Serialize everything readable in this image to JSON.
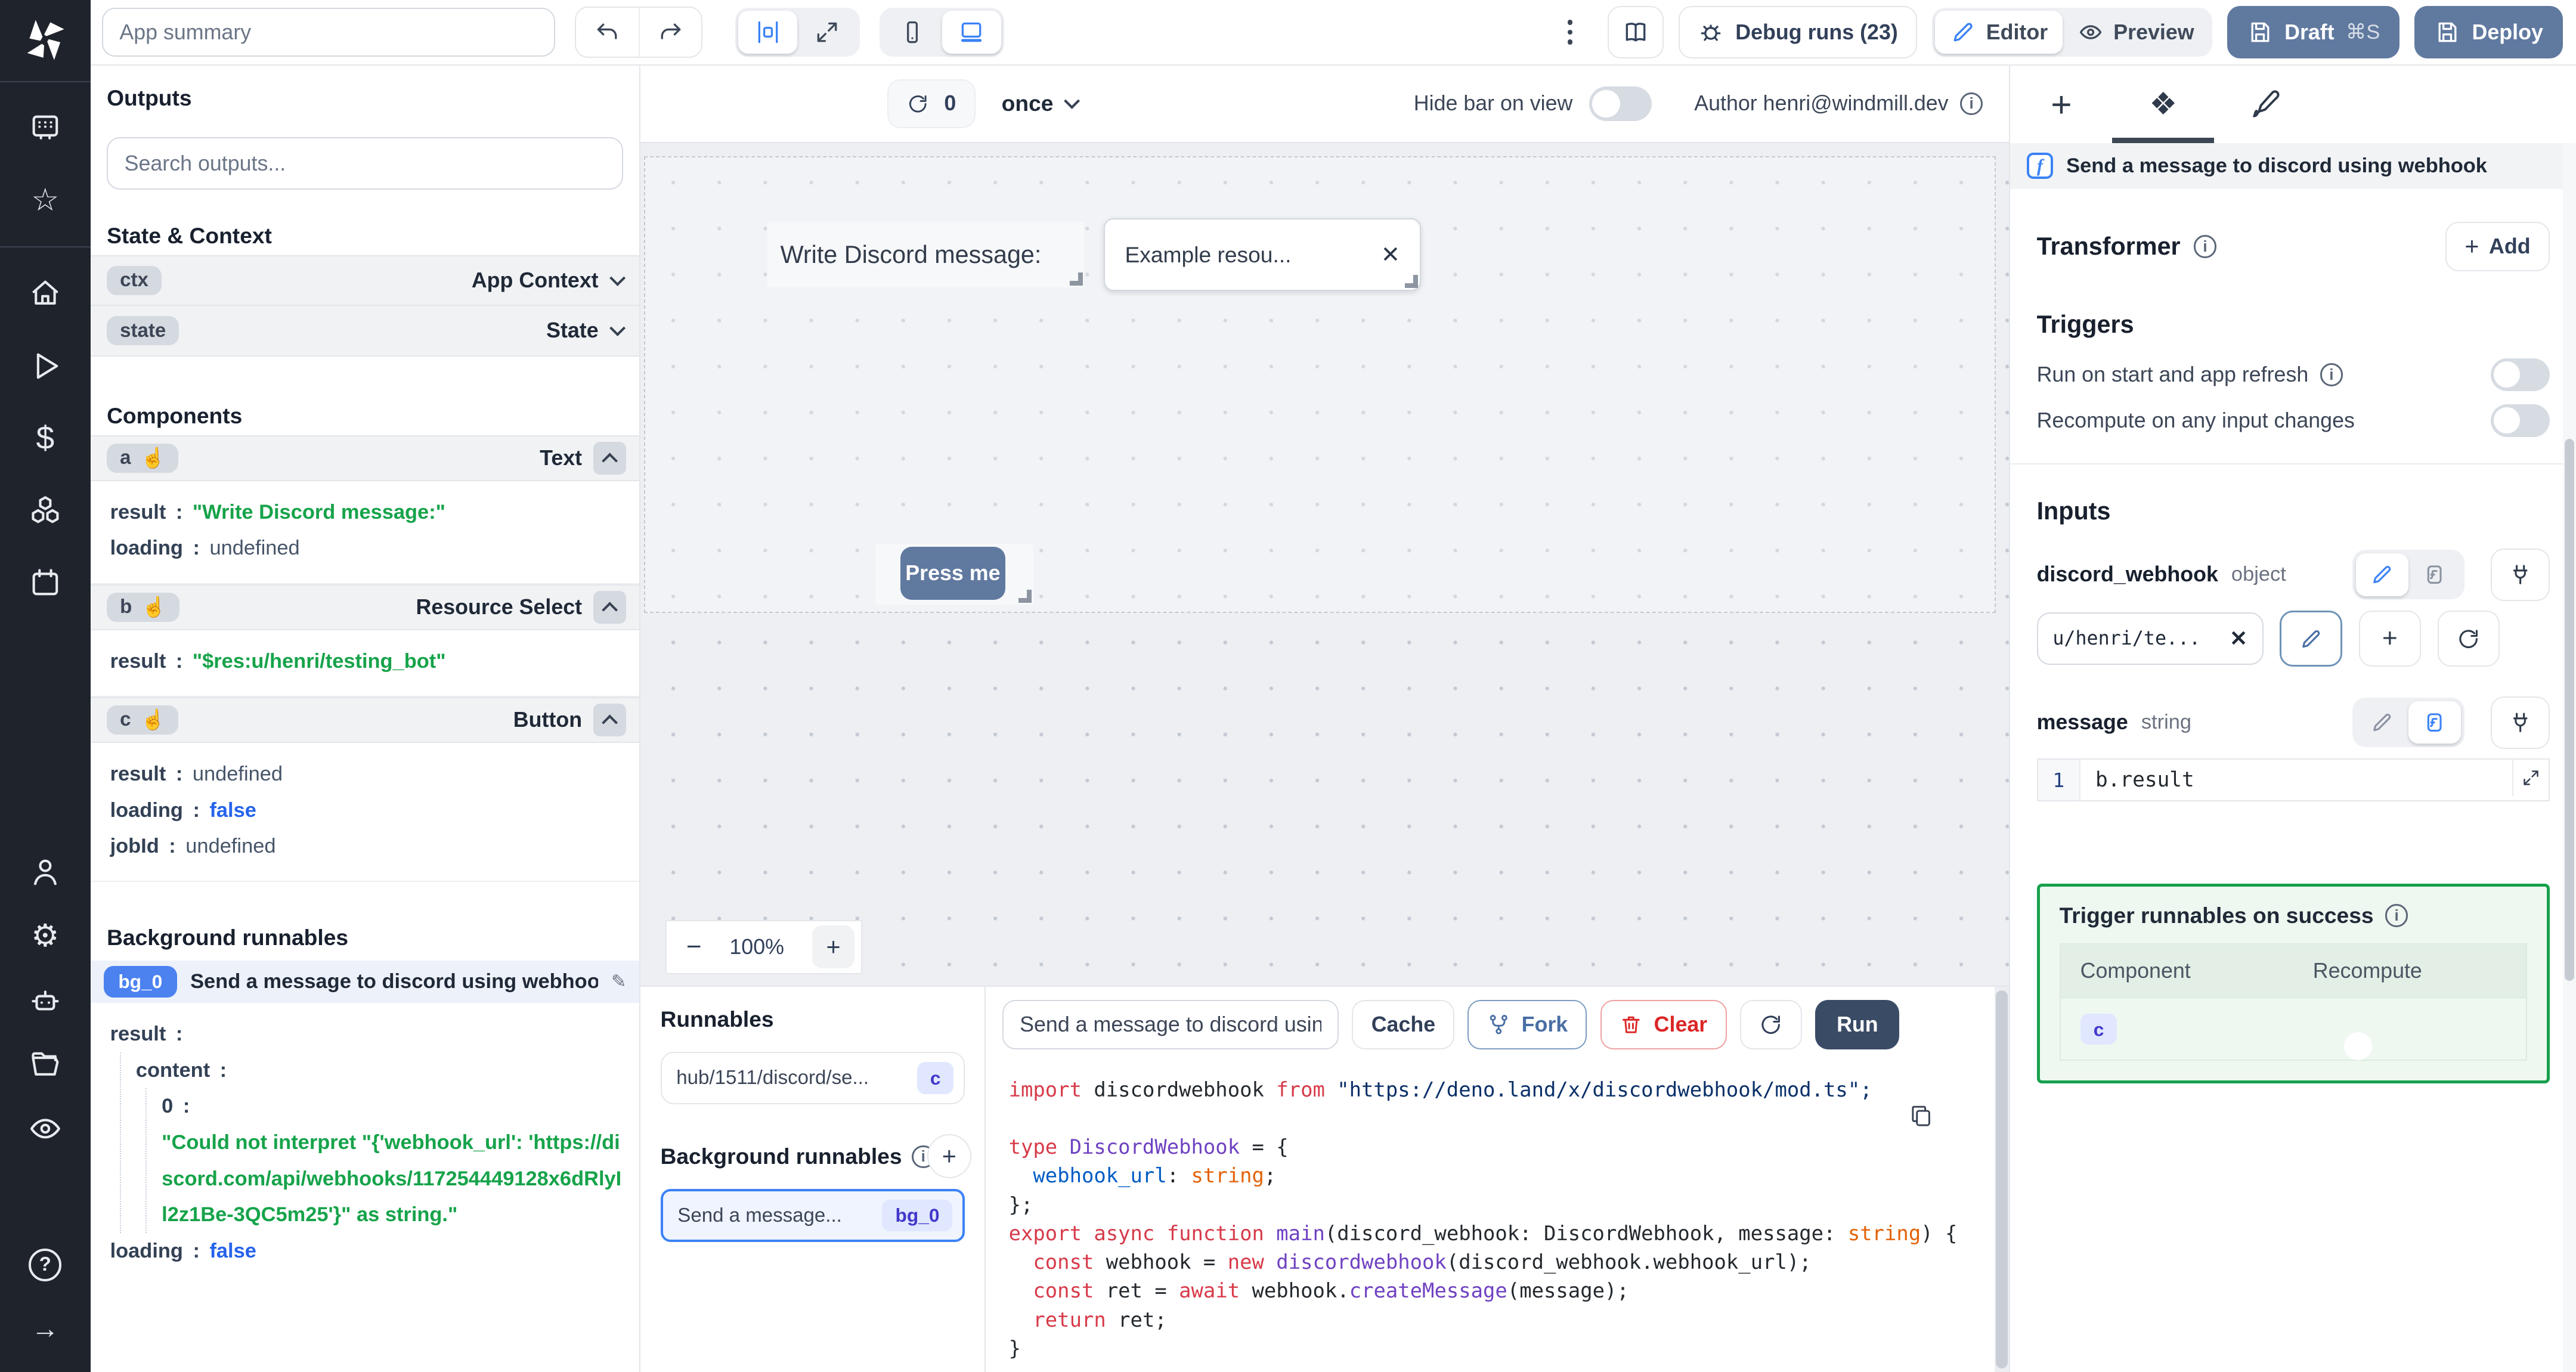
{
  "topbar": {
    "app_summary_placeholder": "App summary",
    "debug_runs": "Debug runs (23)",
    "editor": "Editor",
    "preview": "Preview",
    "draft": "Draft",
    "draft_shortcut": "⌘S",
    "deploy": "Deploy"
  },
  "canvas": {
    "refresh_count": "0",
    "schedule": "once",
    "hide_bar": "Hide bar on view",
    "author": "Author henri@windmill.dev",
    "text_component": "Write Discord message:",
    "select_value": "Example resou...",
    "button_label": "Press me",
    "zoom_level": "100%"
  },
  "outputs": {
    "title": "Outputs",
    "search_placeholder": "Search outputs...",
    "state_context": "State & Context",
    "ctx_id": "ctx",
    "ctx_type": "App Context",
    "state_id": "state",
    "state_type": "State",
    "components": "Components",
    "a_id": "a",
    "a_type": "Text",
    "a_result_k": "result",
    "a_result_v": "\"Write Discord message:\"",
    "a_loading_k": "loading",
    "a_loading_v": "undefined",
    "b_id": "b",
    "b_type": "Resource Select",
    "b_result_k": "result",
    "b_result_v": "\"$res:u/henri/testing_bot\"",
    "c_id": "c",
    "c_type": "Button",
    "c_result_k": "result",
    "c_result_v": "undefined",
    "c_loading_k": "loading",
    "c_loading_v": "false",
    "c_jobid_k": "jobId",
    "c_jobid_v": "undefined",
    "bg_title": "Background runnables",
    "bg_badge": "bg_0",
    "bg_label": "Send a message to discord using webhook",
    "bg_result_k": "result",
    "bg_content_k": "content",
    "bg_index_k": "0",
    "bg_error": "\"Could not interpret \"{'webhook_url': 'https://discord.com/api/webhooks/117254449128x6dRlyIl2z1Be-3QC5m25'}\" as string.\"",
    "bg_loading_k": "loading",
    "bg_loading_v": "false"
  },
  "runnables": {
    "title": "Runnables",
    "item_label": "hub/1511/discord/se...",
    "item_badge": "c",
    "bg_title": "Background runnables",
    "bg_label": "Send a message...",
    "bg_badge": "bg_0"
  },
  "editor": {
    "name_value": "Send a message to discord using",
    "cache": "Cache",
    "fork": "Fork",
    "clear": "Clear",
    "run": "Run",
    "lines": [
      [
        [
          "kw",
          "import"
        ],
        [
          "pl",
          " discordwebhook "
        ],
        [
          "kw",
          "from"
        ],
        [
          "str",
          " \"https://deno.land/x/discordwebhook/mod.ts\";"
        ]
      ],
      [],
      [
        [
          "kw",
          "type"
        ],
        [
          "ty",
          " DiscordWebhook"
        ],
        [
          "pl",
          " = {"
        ]
      ],
      [
        [
          "pr",
          "  webhook_url"
        ],
        [
          "pl",
          ": "
        ],
        [
          "or",
          "string"
        ],
        [
          "pl",
          ";"
        ]
      ],
      [
        [
          "pl",
          "};"
        ]
      ],
      [
        [
          "kw",
          "export async function"
        ],
        [
          "fn",
          " main"
        ],
        [
          "pl",
          "(discord_webhook: DiscordWebhook, message: "
        ],
        [
          "or",
          "string"
        ],
        [
          "pl",
          ") {"
        ]
      ],
      [
        [
          "pl",
          "  "
        ],
        [
          "kw",
          "const"
        ],
        [
          "pl",
          " webhook = "
        ],
        [
          "kw",
          "new"
        ],
        [
          "ty",
          " discordwebhook"
        ],
        [
          "pl",
          "(discord_webhook.webhook_url);"
        ]
      ],
      [
        [
          "pl",
          "  "
        ],
        [
          "kw",
          "const"
        ],
        [
          "pl",
          " ret = "
        ],
        [
          "kw",
          "await"
        ],
        [
          "pl",
          " webhook."
        ],
        [
          "fn",
          "createMessage"
        ],
        [
          "pl",
          "(message);"
        ]
      ],
      [
        [
          "pl",
          "  "
        ],
        [
          "kw",
          "return"
        ],
        [
          "pl",
          " ret;"
        ]
      ],
      [
        [
          "pl",
          "}"
        ]
      ]
    ]
  },
  "right": {
    "header": "Send a message to discord using webhook",
    "transformer": "Transformer",
    "add": "Add",
    "triggers": "Triggers",
    "trigger_run_on_start": "Run on start and app refresh",
    "trigger_recompute": "Recompute on any input changes",
    "inputs": "Inputs",
    "input1_name": "discord_webhook",
    "input1_type": "object",
    "input1_value": "u/henri/te...",
    "input2_name": "message",
    "input2_type": "string",
    "input2_lineno": "1",
    "input2_code": "b.result",
    "success_title": "Trigger runnables on success",
    "col_component": "Component",
    "col_recompute": "Recompute",
    "success_badge": "c"
  }
}
